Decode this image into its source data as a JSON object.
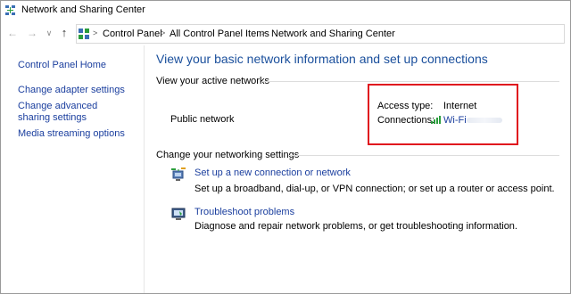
{
  "window": {
    "title": "Network and Sharing Center"
  },
  "breadcrumb": [
    "Control Panel",
    "All Control Panel Items",
    "Network and Sharing Center"
  ],
  "sidebar": {
    "items": [
      {
        "label": "Control Panel Home"
      },
      {
        "label": "Change adapter settings"
      },
      {
        "label": "Change advanced sharing settings"
      },
      {
        "label": "Media streaming options"
      }
    ]
  },
  "main": {
    "title": "View your basic network information and set up connections",
    "active_networks_heading": "View your active networks",
    "network_name": "Public network",
    "access_type_label": "Access type:",
    "access_type_value": "Internet",
    "connections_label": "Connections:",
    "connections_value": "Wi-Fi",
    "change_settings_heading": "Change your networking settings",
    "tasks": [
      {
        "link": "Set up a new connection or network",
        "description": "Set up a broadband, dial-up, or VPN connection; or set up a router or access point."
      },
      {
        "link": "Troubleshoot problems",
        "description": "Diagnose and repair network problems, or get troubleshooting information."
      }
    ]
  },
  "colors": {
    "link": "#1a3e9e",
    "title": "#1a4f9c",
    "highlight": "#e0141e"
  },
  "icons": [
    "network-center-icon",
    "back-arrow-icon",
    "forward-arrow-icon",
    "history-chevron-icon",
    "up-arrow-icon",
    "wifi-signal-icon",
    "new-connection-icon",
    "troubleshoot-icon"
  ]
}
